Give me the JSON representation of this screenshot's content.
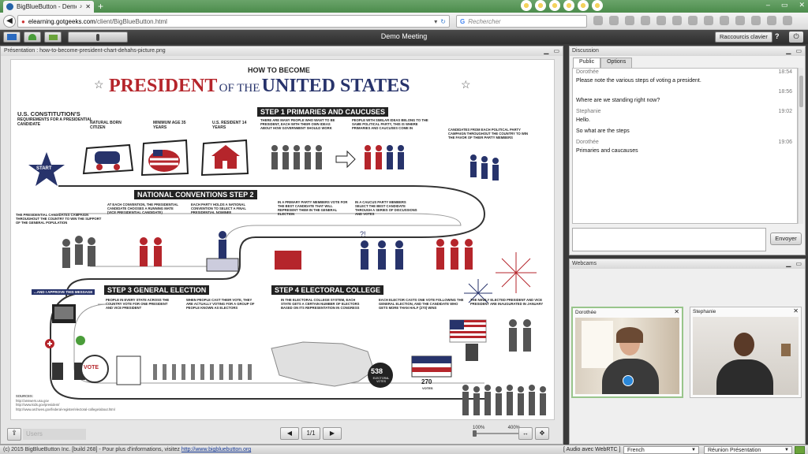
{
  "browser": {
    "tab_title": "BigBlueButton - Demo...",
    "new_tab_symbol": "+",
    "url_host": "elearning.gotgeeks.com",
    "url_path": "/client/BigBlueButton.html",
    "search_placeholder": "Rechercher",
    "window_controls": [
      "–",
      "▭",
      "✕"
    ]
  },
  "toolbar": {
    "meeting_title": "Demo Meeting",
    "shortcuts_label": "Raccourcis clavier",
    "help_label": "?"
  },
  "presentation": {
    "header": "Présentation : how-to-become-president-chart-dehahs-picture.png",
    "users_label": "Users",
    "page_indicator": "1/1",
    "zoom_min": "100%",
    "zoom_max": "400%",
    "slide": {
      "kicker": "HOW TO BECOME",
      "title_a": "PRESIDENT",
      "title_b": "OF THE",
      "title_c": "UNITED STATES",
      "req_title": "U.S. CONSTITUTION'S",
      "req_sub": "REQUIREMENTS FOR A PRESIDENTIAL CANDIDATE",
      "req_1": "NATURAL BORN CITIZEN",
      "req_2": "MINIMUM AGE 35 YEARS",
      "req_3": "U.S. RESIDENT 14 YEARS",
      "start": "START",
      "step1": "STEP 1 PRIMARIES AND CAUCUSES",
      "step1_t1": "THERE ARE MANY PEOPLE WHO WANT TO BE PRESIDENT, EACH WITH THEIR OWN IDEAS ABOUT HOW GOVERNMENT SHOULD WORK",
      "step1_t2": "PEOPLE WITH SIMILAR IDEAS BELONG TO THE SAME POLITICAL PARTY, THIS IS WHERE PRIMARIES AND CAUCUSES COME IN",
      "step1_t3": "CANDIDATES FROM EACH POLITICAL PARTY CAMPAIGN THROUGHOUT THE COUNTRY TO WIN THE FAVOR OF THEIR PARTY MEMBERS",
      "step2": "NATIONAL CONVENTIONS STEP 2",
      "step2_t1": "AT EACH CONVENTION, THE PRESIDENTIAL CANDIDATE CHOOSES A RUNNING MATE (VICE PRESIDENTIAL CANDIDATE)",
      "step2_t2": "EACH PARTY HOLDS A NATIONAL CONVENTION TO SELECT A FINAL PRESIDENTIAL NOMINEE",
      "step2_t3": "THE PRESIDENTIAL CANDIDATES CAMPAIGN THROUGHOUT THE COUNTRY TO WIN THE SUPPORT OF THE GENERAL POPULATION",
      "primary_t": "IN A PRIMARY PARTY MEMBERS VOTE FOR THE BEST CANDIDATE THAT WILL REPRESENT THEM IN THE GENERAL ELECTION",
      "caucus_t": "IN A CAUCUS PARTY MEMBERS SELECT THE BEST CANDIDATE THROUGH A SERIES OF DISCUSSIONS AND VOTES",
      "approve": "...AND I APPROVE THIS MESSAGE",
      "step3": "STEP 3 GENERAL ELECTION",
      "step3_t1": "PEOPLE IN EVERY STATE ACROSS THE COUNTRY VOTE FOR ONE PRESIDENT AND VICE PRESIDENT",
      "step3_t2": "WHEN PEOPLE CAST THEIR VOTE, THEY ARE ACTUALLY VOTING FOR A GROUP OF PEOPLE KNOWN AS ELECTORS",
      "step4": "STEP 4 ELECTORAL COLLEGE",
      "step4_t1": "IN THE ELECTORAL COLLEGE SYSTEM, EACH STATE GETS A CERTAIN NUMBER OF ELECTORS BASED ON ITS REPRESENTATION IN CONGRESS",
      "step4_t2": "EACH ELECTOR CASTS ONE VOTE FOLLOWING THE GENERAL ELECTION, AND THE CANDIDATE WHO GETS MORE THAN HALF (270) WINS",
      "step4_t3": "THE NEWLY ELECTED PRESIDENT AND VICE PRESIDENT ARE INAUGURATED IN JANUARY",
      "vote": "VOTE",
      "electoral_num": "538",
      "electoral_lbl": "ELECTORAL VOTES",
      "votes_num": "270",
      "votes_lbl": "VOTES",
      "sources_title": "SOURCES:",
      "source_1": "http://answers.usa.gov",
      "source_2": "http://www.kids.gov/president/",
      "source_3": "http://www.archives.gov/federal-register/electoral-college/about.html"
    }
  },
  "discussion": {
    "title": "Discussion",
    "tabs": [
      "Public",
      "Options"
    ],
    "messages": [
      {
        "who": "Dorothée",
        "time": "18:54",
        "text": "Please note the various steps of voting a president."
      },
      {
        "who": "",
        "time": "18:56",
        "text": "Where are we standing right now?"
      },
      {
        "who": "Stephanie",
        "time": "19:02",
        "text": "Hello."
      },
      {
        "who": "",
        "time": "",
        "text": "So what are the steps"
      },
      {
        "who": "Dorothée",
        "time": "19:06",
        "text": "Primaries and caucauses"
      }
    ],
    "send_label": "Envoyer"
  },
  "webcams": {
    "title": "Webcams",
    "cams": [
      {
        "name": "Dorothée"
      },
      {
        "name": "Stephanie"
      }
    ]
  },
  "statusbar": {
    "copyright": "(c) 2015 BigBlueButton Inc. [build 268] - Pour plus d'informations, visitez",
    "link": "http://www.bigbluebutton.org",
    "audio": "[ Audio avec WebRTC ]",
    "language": "French",
    "layout": "Réunion Présentation"
  },
  "colors": {
    "accent_red": "#b5252b",
    "navy": "#27336b",
    "speaking_border": "#98c58b"
  }
}
